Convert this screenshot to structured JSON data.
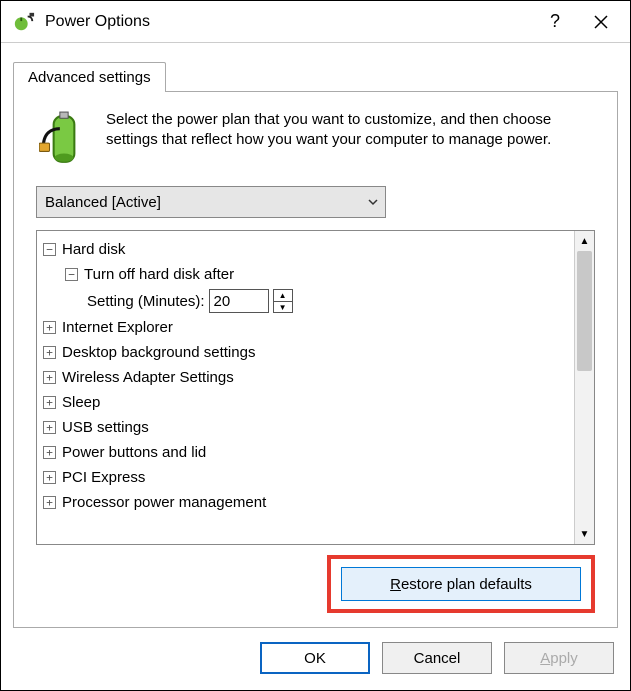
{
  "window": {
    "title": "Power Options",
    "help_symbol": "?",
    "close_symbol": "✕"
  },
  "tab": {
    "label": "Advanced settings"
  },
  "intro": {
    "text": "Select the power plan that you want to customize, and then choose settings that reflect how you want your computer to manage power."
  },
  "plan": {
    "selected": "Balanced [Active]"
  },
  "tree": {
    "hard_disk": {
      "label": "Hard disk",
      "turn_off": {
        "label": "Turn off hard disk after",
        "setting_label": "Setting (Minutes):",
        "value": "20"
      }
    },
    "ie": {
      "label": "Internet Explorer"
    },
    "desktop_bg": {
      "label": "Desktop background settings"
    },
    "wireless": {
      "label": "Wireless Adapter Settings"
    },
    "sleep": {
      "label": "Sleep"
    },
    "usb": {
      "label": "USB settings"
    },
    "power_buttons": {
      "label": "Power buttons and lid"
    },
    "pci": {
      "label": "PCI Express"
    },
    "processor": {
      "label": "Processor power management"
    }
  },
  "buttons": {
    "restore_prefix": "R",
    "restore_rest": "estore plan defaults",
    "ok": "OK",
    "cancel": "Cancel",
    "apply_prefix": "A",
    "apply_rest": "pply"
  }
}
